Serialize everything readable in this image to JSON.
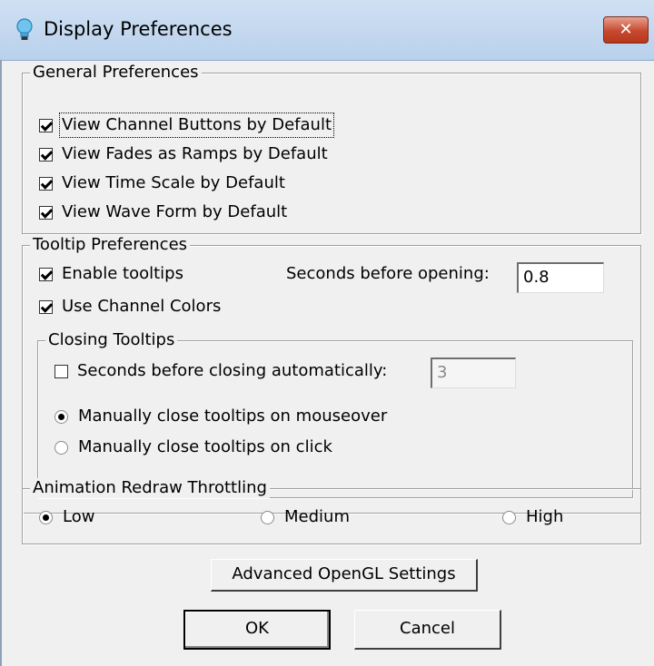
{
  "window": {
    "title": "Display Preferences",
    "close_label": "✕"
  },
  "general": {
    "legend": "General Preferences",
    "items": [
      {
        "label": "View Channel Buttons by Default",
        "checked": true
      },
      {
        "label": "View Fades as Ramps by Default",
        "checked": true
      },
      {
        "label": "View Time Scale by Default",
        "checked": true
      },
      {
        "label": "View Wave Form by Default",
        "checked": true
      }
    ]
  },
  "tooltip": {
    "legend": "Tooltip Preferences",
    "enable_label": "Enable tooltips",
    "enable_checked": true,
    "channel_colors_label": "Use Channel Colors",
    "channel_colors_checked": true,
    "seconds_opening_label": "Seconds before opening:",
    "seconds_opening_value": "0.8",
    "closing": {
      "legend": "Closing Tooltips",
      "auto_label": "Seconds before closing automatically:",
      "auto_checked": false,
      "auto_value": "3",
      "mouseover_label": "Manually close tooltips on mouseover",
      "mouseover_selected": true,
      "click_label": "Manually close tooltips on click",
      "click_selected": false
    }
  },
  "animation": {
    "legend": "Animation Redraw Throttling",
    "options": [
      {
        "label": "Low",
        "selected": true
      },
      {
        "label": "Medium",
        "selected": false
      },
      {
        "label": "High",
        "selected": false
      }
    ]
  },
  "buttons": {
    "advanced_label": "Advanced OpenGL Settings",
    "ok_label": "OK",
    "cancel_label": "Cancel"
  },
  "colors": {
    "titlebar": "#c4d8ef",
    "close_button": "#c6492e",
    "dialog_background": "#f0f0f0"
  }
}
